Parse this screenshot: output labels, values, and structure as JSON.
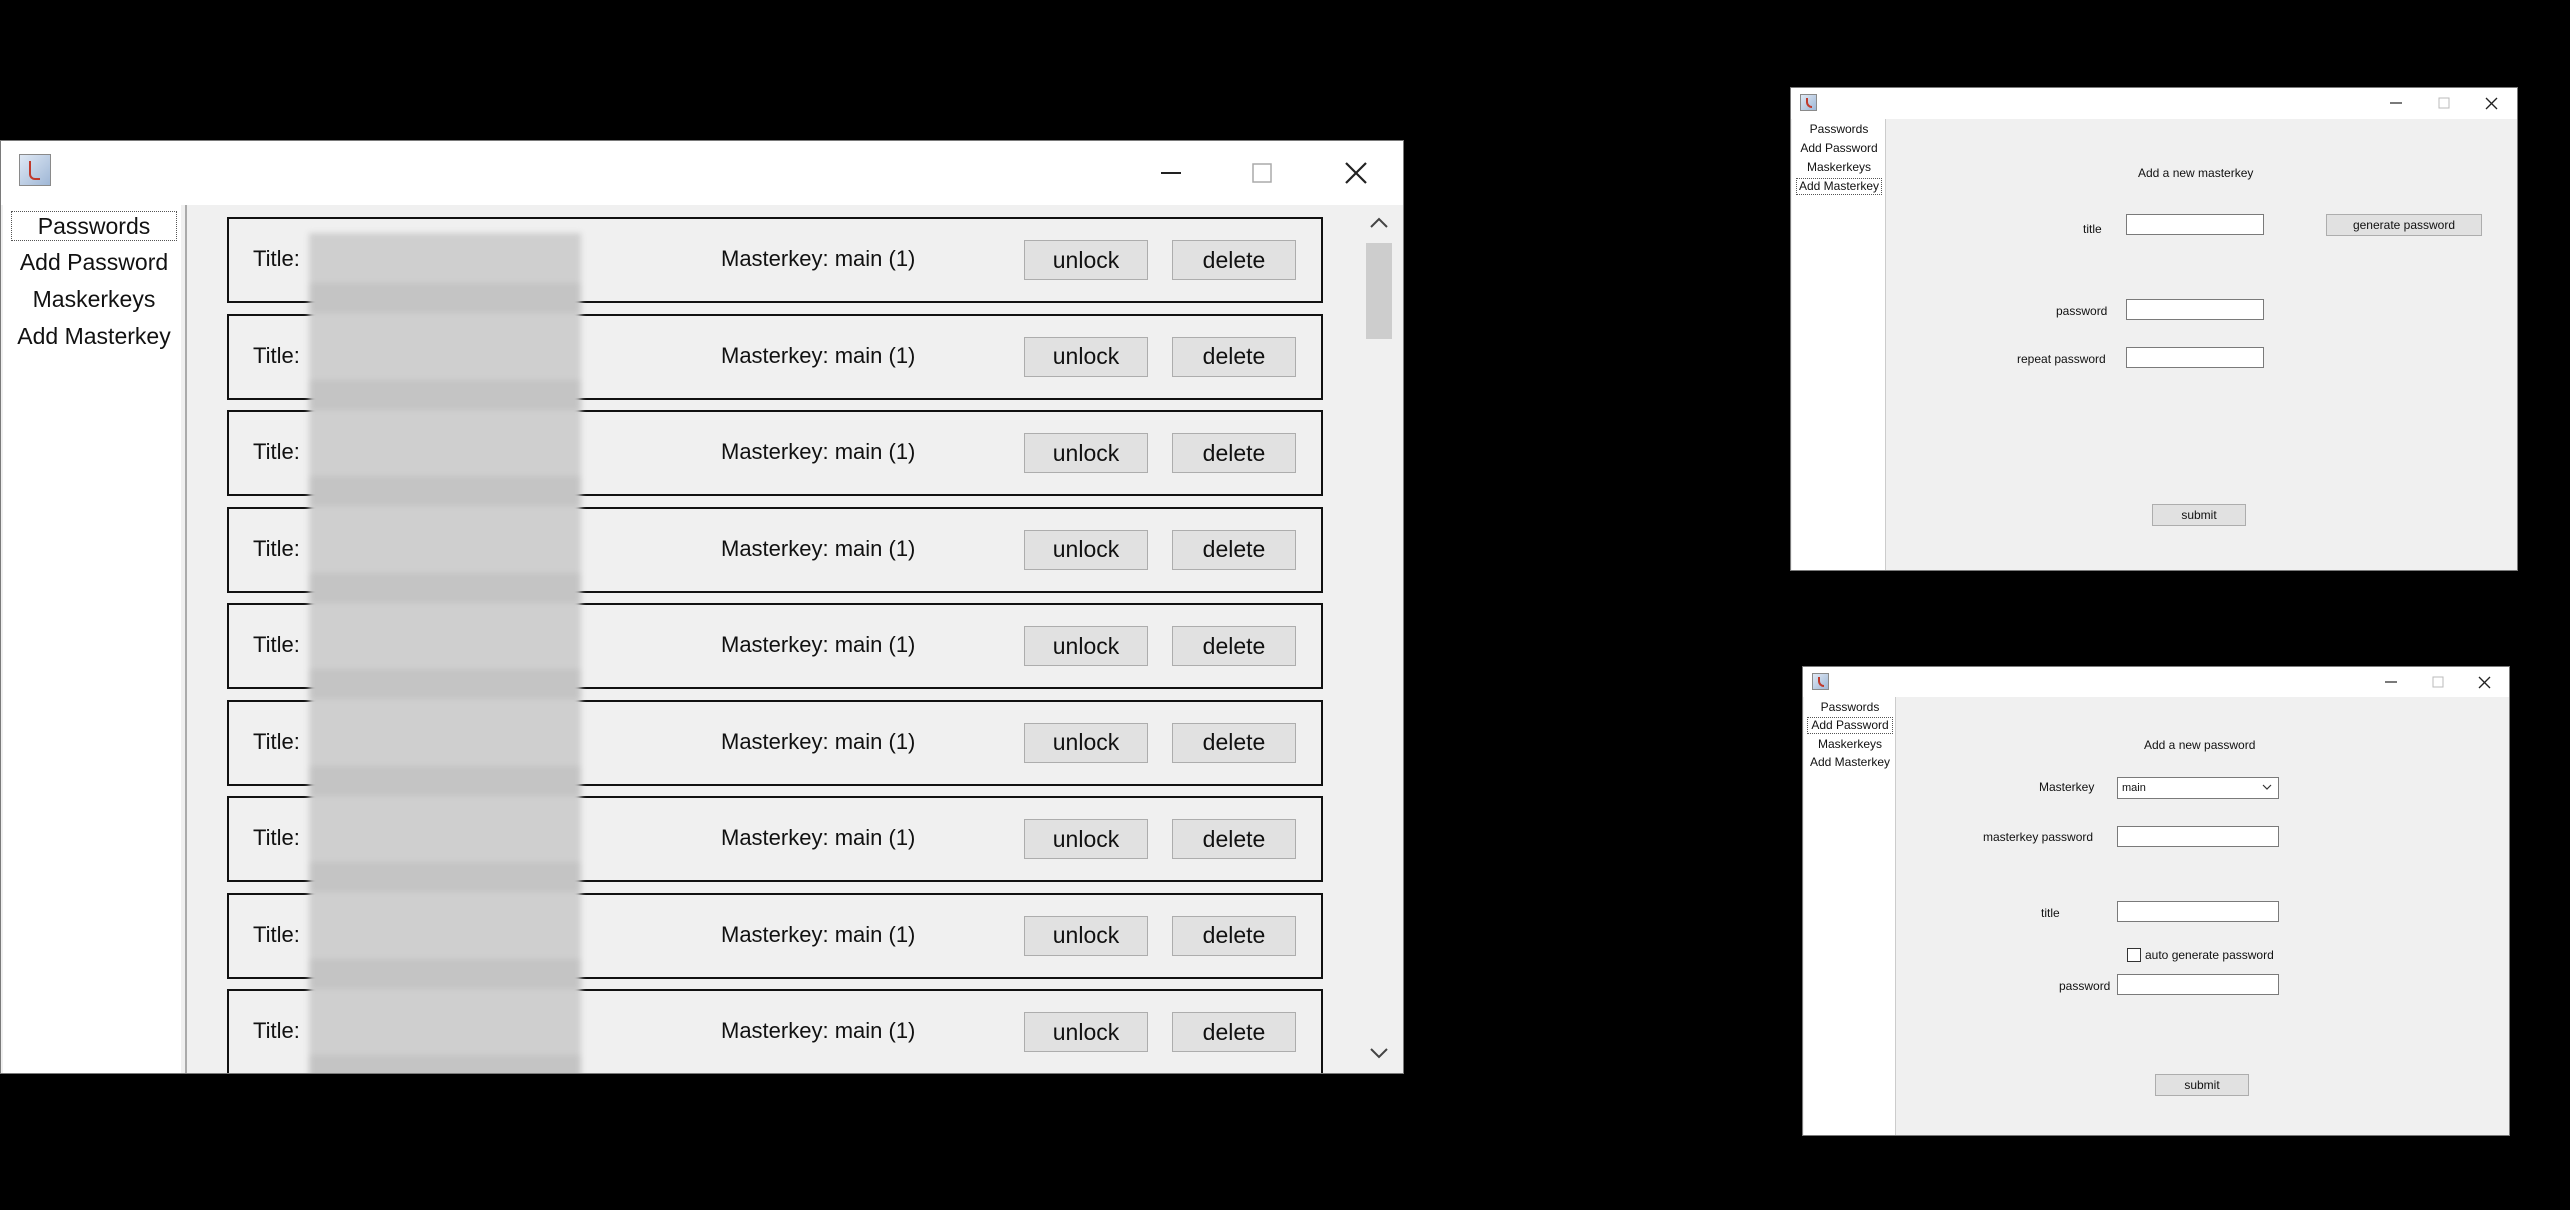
{
  "passwords_window": {
    "nav": [
      "Passwords",
      "Add Password",
      "Maskerkeys",
      "Add Masterkey"
    ],
    "selected_nav": 0,
    "title_label": "Title:",
    "masterkey_label": "Masterkey: main (1)",
    "unlock_label": "unlock",
    "delete_label": "delete",
    "row_count": 9
  },
  "add_masterkey_window": {
    "nav": [
      "Passwords",
      "Add Password",
      "Maskerkeys",
      "Add Masterkey"
    ],
    "selected_nav": 3,
    "heading": "Add a new masterkey",
    "title_label": "title",
    "generate_button": "generate password",
    "password_label": "password",
    "repeat_password_label": "repeat password",
    "submit_button": "submit"
  },
  "add_password_window": {
    "nav": [
      "Passwords",
      "Add Password",
      "Maskerkeys",
      "Add Masterkey"
    ],
    "selected_nav": 1,
    "heading": "Add a new password",
    "masterkey_label": "Masterkey",
    "masterkey_selected": "main",
    "masterkey_password_label": "masterkey password",
    "title_label": "title",
    "auto_generate_label": "auto generate password",
    "auto_generate_checked": false,
    "password_label": "password",
    "submit_button": "submit"
  },
  "icons": [
    "java-app-icon",
    "minimize-icon",
    "maximize-icon",
    "close-icon",
    "scroll-up-icon",
    "scroll-down-icon",
    "chevron-down-icon"
  ]
}
